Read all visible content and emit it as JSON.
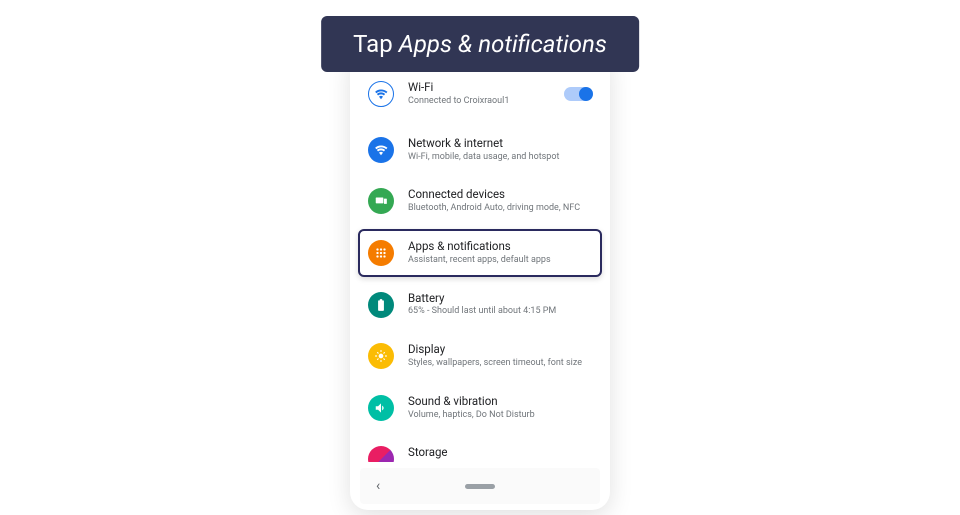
{
  "banner": {
    "prefix": "Tap ",
    "emphasis": "Apps & notifications"
  },
  "settings": {
    "wifi": {
      "title": "Wi-Fi",
      "subtitle": "Connected to Croixraoul1",
      "icon_color": "#ffffff",
      "icon_border": "#1a73e8"
    },
    "network": {
      "title": "Network & internet",
      "subtitle": "Wi-Fi, mobile, data usage, and hotspot",
      "icon_bg": "#1a73e8"
    },
    "connected": {
      "title": "Connected devices",
      "subtitle": "Bluetooth, Android Auto, driving mode, NFC",
      "icon_bg": "#34a853"
    },
    "apps": {
      "title": "Apps & notifications",
      "subtitle": "Assistant, recent apps, default apps",
      "icon_bg": "#f57c00"
    },
    "battery": {
      "title": "Battery",
      "subtitle": "65% - Should last until about 4:15 PM",
      "icon_bg": "#00897b"
    },
    "display": {
      "title": "Display",
      "subtitle": "Styles, wallpapers, screen timeout, font size",
      "icon_bg": "#fbbc04"
    },
    "sound": {
      "title": "Sound & vibration",
      "subtitle": "Volume, haptics, Do Not Disturb",
      "icon_bg": "#00bfa5"
    },
    "storage": {
      "title": "Storage"
    }
  }
}
